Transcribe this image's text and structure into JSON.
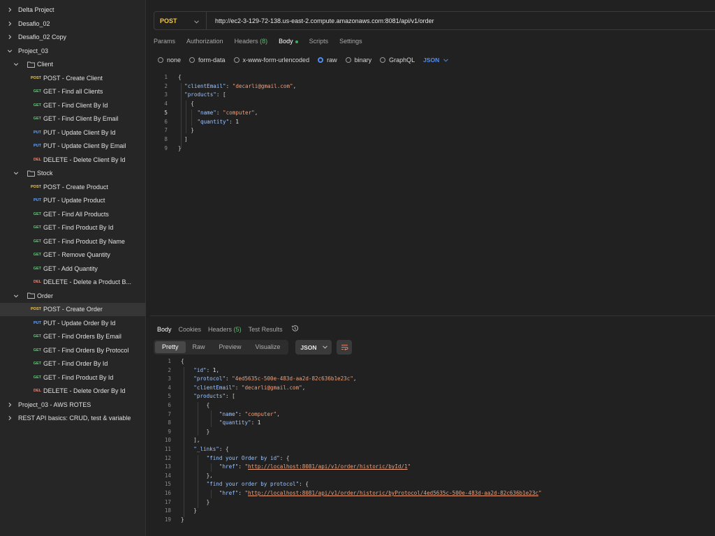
{
  "sidebar": {
    "items": [
      {
        "type": "collection",
        "label": "Delta Project",
        "expanded": false
      },
      {
        "type": "collection",
        "label": "Desafio_02",
        "expanded": false
      },
      {
        "type": "collection",
        "label": "Desafio_02 Copy",
        "expanded": false
      },
      {
        "type": "collection",
        "label": "Project_03",
        "expanded": true
      },
      {
        "type": "folder",
        "label": "Client",
        "expanded": true
      },
      {
        "type": "request",
        "method": "POST",
        "label": "POST - Create Client"
      },
      {
        "type": "request",
        "method": "GET",
        "label": "GET - Find all Clients"
      },
      {
        "type": "request",
        "method": "GET",
        "label": "GET - Find Client By Id"
      },
      {
        "type": "request",
        "method": "GET",
        "label": "GET - Find Client By Email"
      },
      {
        "type": "request",
        "method": "PUT",
        "label": "PUT - Update Client By Id"
      },
      {
        "type": "request",
        "method": "PUT",
        "label": "PUT - Update Client By Email"
      },
      {
        "type": "request",
        "method": "DEL",
        "label": "DELETE - Delete Client By Id"
      },
      {
        "type": "folder",
        "label": "Stock",
        "expanded": true
      },
      {
        "type": "request",
        "method": "POST",
        "label": "POST - Create Product"
      },
      {
        "type": "request",
        "method": "PUT",
        "label": "PUT - Update Product"
      },
      {
        "type": "request",
        "method": "GET",
        "label": "GET - Find All Products"
      },
      {
        "type": "request",
        "method": "GET",
        "label": "GET - Find Product By Id"
      },
      {
        "type": "request",
        "method": "GET",
        "label": "GET - Find Product By Name"
      },
      {
        "type": "request",
        "method": "GET",
        "label": "GET - Remove Quantity"
      },
      {
        "type": "request",
        "method": "GET",
        "label": "GET - Add Quantity"
      },
      {
        "type": "request",
        "method": "DEL",
        "label": "DELETE - Delete a Product B..."
      },
      {
        "type": "folder",
        "label": "Order",
        "expanded": true
      },
      {
        "type": "request",
        "method": "POST",
        "label": "POST - Create Order",
        "selected": true
      },
      {
        "type": "request",
        "method": "PUT",
        "label": "PUT - Update Order By Id"
      },
      {
        "type": "request",
        "method": "GET",
        "label": "GET - Find Orders By Email"
      },
      {
        "type": "request",
        "method": "GET",
        "label": "GET - Find Orders By Protocol"
      },
      {
        "type": "request",
        "method": "GET",
        "label": "GET - Find Order By Id"
      },
      {
        "type": "request",
        "method": "GET",
        "label": "GET - Find Product By Id"
      },
      {
        "type": "request",
        "method": "DEL",
        "label": "DELETE - Delete Order By Id"
      },
      {
        "type": "collection",
        "label": "Project_03 - AWS ROTES",
        "expanded": false
      },
      {
        "type": "collection",
        "label": "REST API basics: CRUD, test & variable",
        "expanded": false
      }
    ]
  },
  "request": {
    "method": "POST",
    "url": "http://ec2-3-129-72-138.us-east-2.compute.amazonaws.com:8081/api/v1/order",
    "tabs": [
      {
        "label": "Params"
      },
      {
        "label": "Authorization"
      },
      {
        "label": "Headers",
        "count": "(8)"
      },
      {
        "label": "Body",
        "active": true,
        "dot": true
      },
      {
        "label": "Scripts"
      },
      {
        "label": "Settings"
      }
    ],
    "body_options": [
      {
        "label": "none",
        "checked": false
      },
      {
        "label": "form-data",
        "checked": false
      },
      {
        "label": "x-www-form-urlencoded",
        "checked": false
      },
      {
        "label": "raw",
        "checked": true
      },
      {
        "label": "binary",
        "checked": false
      },
      {
        "label": "GraphQL",
        "checked": false
      }
    ],
    "body_format": "JSON",
    "body_lines": [
      [
        [
          "p",
          "{"
        ]
      ],
      [
        [
          "p",
          "  "
        ],
        [
          "k",
          "\"clientEmail\""
        ],
        [
          "p",
          ": "
        ],
        [
          "s",
          "\"decarli@gmail.com\""
        ],
        [
          "p",
          ","
        ]
      ],
      [
        [
          "p",
          "  "
        ],
        [
          "k",
          "\"products\""
        ],
        [
          "p",
          ": ["
        ]
      ],
      [
        [
          "p",
          "    {"
        ]
      ],
      [
        [
          "p",
          "      "
        ],
        [
          "k",
          "\"name\""
        ],
        [
          "p",
          ": "
        ],
        [
          "s",
          "\"computer\""
        ],
        [
          "p",
          ","
        ]
      ],
      [
        [
          "p",
          "      "
        ],
        [
          "k",
          "\"quantity\""
        ],
        [
          "p",
          ": "
        ],
        [
          "n",
          "1"
        ]
      ],
      [
        [
          "p",
          "    }"
        ]
      ],
      [
        [
          "p",
          "  ]"
        ]
      ],
      [
        [
          "p",
          "}"
        ]
      ]
    ],
    "current_line": 5
  },
  "response": {
    "tabs": [
      {
        "label": "Body",
        "active": true
      },
      {
        "label": "Cookies"
      },
      {
        "label": "Headers",
        "count": "(5)"
      },
      {
        "label": "Test Results"
      }
    ],
    "view_modes": [
      {
        "label": "Pretty",
        "active": true
      },
      {
        "label": "Raw"
      },
      {
        "label": "Preview"
      },
      {
        "label": "Visualize"
      }
    ],
    "format": "JSON",
    "lines": [
      [
        [
          "p",
          "{"
        ]
      ],
      [
        [
          "p",
          "    "
        ],
        [
          "k",
          "\"id\""
        ],
        [
          "p",
          ": "
        ],
        [
          "n",
          "1"
        ],
        [
          "p",
          ","
        ]
      ],
      [
        [
          "p",
          "    "
        ],
        [
          "k",
          "\"protocol\""
        ],
        [
          "p",
          ": "
        ],
        [
          "s",
          "\"4ed5635c-500e-483d-aa2d-82c636b1e23c\""
        ],
        [
          "p",
          ","
        ]
      ],
      [
        [
          "p",
          "    "
        ],
        [
          "k",
          "\"clientEmail\""
        ],
        [
          "p",
          ": "
        ],
        [
          "s",
          "\"decarli@gmail.com\""
        ],
        [
          "p",
          ","
        ]
      ],
      [
        [
          "p",
          "    "
        ],
        [
          "k",
          "\"products\""
        ],
        [
          "p",
          ": ["
        ]
      ],
      [
        [
          "p",
          "        {"
        ]
      ],
      [
        [
          "p",
          "            "
        ],
        [
          "k",
          "\"name\""
        ],
        [
          "p",
          ": "
        ],
        [
          "s",
          "\"computer\""
        ],
        [
          "p",
          ","
        ]
      ],
      [
        [
          "p",
          "            "
        ],
        [
          "k",
          "\"quantity\""
        ],
        [
          "p",
          ": "
        ],
        [
          "n",
          "1"
        ]
      ],
      [
        [
          "p",
          "        }"
        ]
      ],
      [
        [
          "p",
          "    ],"
        ]
      ],
      [
        [
          "p",
          "    "
        ],
        [
          "k",
          "\"_links\""
        ],
        [
          "p",
          ": {"
        ]
      ],
      [
        [
          "p",
          "        "
        ],
        [
          "k",
          "\"find your Order by id\""
        ],
        [
          "p",
          ": {"
        ]
      ],
      [
        [
          "p",
          "            "
        ],
        [
          "k",
          "\"href\""
        ],
        [
          "p",
          ": "
        ],
        [
          "s",
          "\""
        ],
        [
          "u",
          "http://localhost:8081/api/v1/order/historic/byId/1"
        ],
        [
          "s",
          "\""
        ]
      ],
      [
        [
          "p",
          "        },"
        ]
      ],
      [
        [
          "p",
          "        "
        ],
        [
          "k",
          "\"find your order by protocol\""
        ],
        [
          "p",
          ": {"
        ]
      ],
      [
        [
          "p",
          "            "
        ],
        [
          "k",
          "\"href\""
        ],
        [
          "p",
          ": "
        ],
        [
          "s",
          "\""
        ],
        [
          "u",
          "http://localhost:8081/api/v1/order/historic/byProtocol/4ed5635c-500e-483d-aa2d-82c636b1e23c"
        ],
        [
          "s",
          "\""
        ]
      ],
      [
        [
          "p",
          "        }"
        ]
      ],
      [
        [
          "p",
          "    }"
        ]
      ],
      [
        [
          "p",
          "}"
        ]
      ]
    ]
  }
}
